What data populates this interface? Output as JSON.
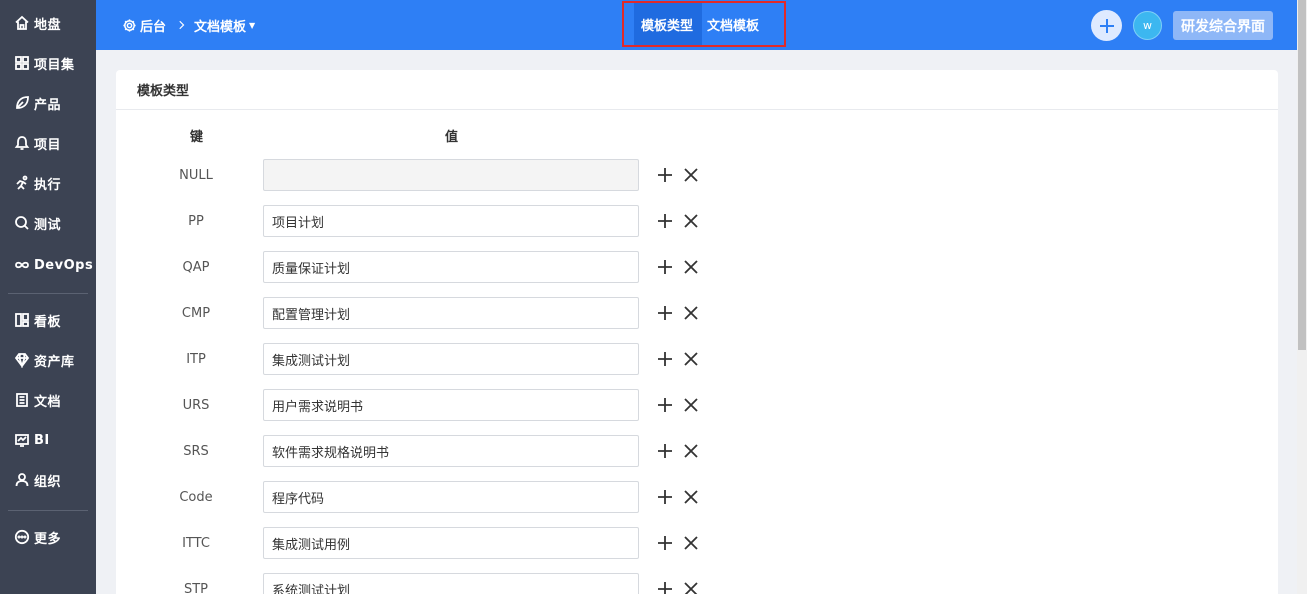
{
  "sidebar": {
    "items": [
      {
        "label": "地盘",
        "icon": "home-icon"
      },
      {
        "label": "项目集",
        "icon": "grid-icon"
      },
      {
        "label": "产品",
        "icon": "leaf-icon"
      },
      {
        "label": "项目",
        "icon": "bell-icon"
      },
      {
        "label": "执行",
        "icon": "run-icon"
      },
      {
        "label": "测试",
        "icon": "search-icon"
      },
      {
        "label": "DevOps",
        "icon": "infinity-icon"
      },
      {
        "label": "看板",
        "icon": "board-icon"
      },
      {
        "label": "资产库",
        "icon": "diamond-icon"
      },
      {
        "label": "文档",
        "icon": "document-icon"
      },
      {
        "label": "BI",
        "icon": "chart-icon"
      },
      {
        "label": "组织",
        "icon": "user-icon"
      },
      {
        "label": "更多",
        "icon": "more-icon"
      }
    ]
  },
  "header": {
    "breadcrumb_root": "后台",
    "breadcrumb_current": "文档模板",
    "tabs": [
      {
        "label": "模板类型",
        "active": true
      },
      {
        "label": "文档模板",
        "active": false
      }
    ],
    "avatar_letter": "w",
    "switch_label": "研发综合界面"
  },
  "panel": {
    "title": "模板类型",
    "key_header": "键",
    "value_header": "值",
    "rows": [
      {
        "key": "NULL",
        "value": ""
      },
      {
        "key": "PP",
        "value": "项目计划"
      },
      {
        "key": "QAP",
        "value": "质量保证计划"
      },
      {
        "key": "CMP",
        "value": "配置管理计划"
      },
      {
        "key": "ITP",
        "value": "集成测试计划"
      },
      {
        "key": "URS",
        "value": "用户需求说明书"
      },
      {
        "key": "SRS",
        "value": "软件需求规格说明书"
      },
      {
        "key": "Code",
        "value": "程序代码"
      },
      {
        "key": "ITTC",
        "value": "集成测试用例"
      },
      {
        "key": "STP",
        "value": "系统测试计划"
      }
    ]
  },
  "colors": {
    "header_blue": "#2e7ff5",
    "sidebar_dark": "#3c4353",
    "highlight_border": "#e02a2a"
  }
}
